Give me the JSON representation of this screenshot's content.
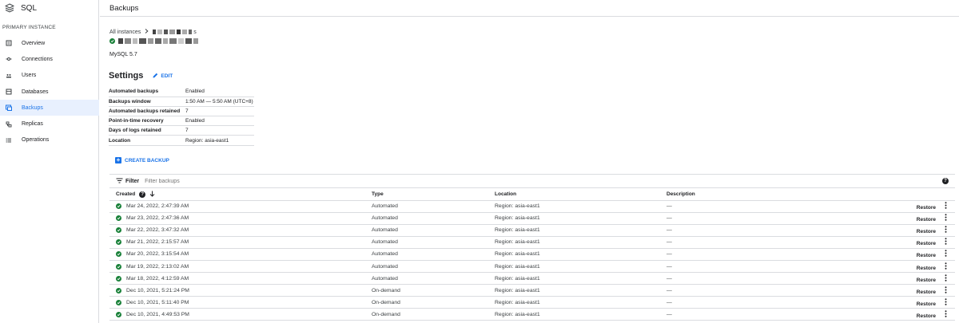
{
  "sidebar": {
    "product": "SQL",
    "section_title": "PRIMARY INSTANCE",
    "items": [
      {
        "label": "Overview"
      },
      {
        "label": "Connections"
      },
      {
        "label": "Users"
      },
      {
        "label": "Databases"
      },
      {
        "label": "Backups",
        "active": true
      },
      {
        "label": "Replicas"
      },
      {
        "label": "Operations"
      }
    ]
  },
  "header": {
    "title": "Backups"
  },
  "breadcrumb": {
    "all_instances": "All instances",
    "instance_suffix": "s"
  },
  "instance": {
    "version": "MySQL 5.7"
  },
  "settings": {
    "title": "Settings",
    "edit_label": "EDIT",
    "rows": [
      {
        "key": "Automated backups",
        "value": "Enabled"
      },
      {
        "key": "Backups window",
        "value": "1:50 AM — 5:50 AM (UTC+8)"
      },
      {
        "key": "Automated backups retained",
        "value": "7"
      },
      {
        "key": "Point-in-time recovery",
        "value": "Enabled"
      },
      {
        "key": "Days of logs retained",
        "value": "7"
      },
      {
        "key": "Location",
        "value": "Region: asia-east1"
      }
    ]
  },
  "create_backup_label": "CREATE BACKUP",
  "filter": {
    "label": "Filter",
    "placeholder": "Filter backups"
  },
  "table": {
    "columns": {
      "created": "Created",
      "type": "Type",
      "location": "Location",
      "description": "Description"
    },
    "restore_label": "Restore",
    "rows": [
      {
        "created": "Mar 24, 2022, 2:47:39 AM",
        "type": "Automated",
        "location": "Region: asia-east1",
        "description": "—"
      },
      {
        "created": "Mar 23, 2022, 2:47:36 AM",
        "type": "Automated",
        "location": "Region: asia-east1",
        "description": "—"
      },
      {
        "created": "Mar 22, 2022, 3:47:32 AM",
        "type": "Automated",
        "location": "Region: asia-east1",
        "description": "—"
      },
      {
        "created": "Mar 21, 2022, 2:15:57 AM",
        "type": "Automated",
        "location": "Region: asia-east1",
        "description": "—"
      },
      {
        "created": "Mar 20, 2022, 3:15:54 AM",
        "type": "Automated",
        "location": "Region: asia-east1",
        "description": "—"
      },
      {
        "created": "Mar 19, 2022, 2:13:02 AM",
        "type": "Automated",
        "location": "Region: asia-east1",
        "description": "—"
      },
      {
        "created": "Mar 18, 2022, 4:12:59 AM",
        "type": "Automated",
        "location": "Region: asia-east1",
        "description": "—"
      },
      {
        "created": "Dec 10, 2021, 5:21:24 PM",
        "type": "On-demand",
        "location": "Region: asia-east1",
        "description": "—"
      },
      {
        "created": "Dec 10, 2021, 5:11:40 PM",
        "type": "On-demand",
        "location": "Region: asia-east1",
        "description": "—"
      },
      {
        "created": "Dec 10, 2021, 4:49:53 PM",
        "type": "On-demand",
        "location": "Region: asia-east1",
        "description": "—"
      }
    ]
  },
  "colors": {
    "accent": "#1a73e8",
    "success": "#188038",
    "border": "#dadce0",
    "active_bg": "#e8f0fe"
  },
  "icons": {
    "nav": [
      "overview-icon",
      "connections-icon",
      "users-icon",
      "databases-icon",
      "backups-icon",
      "replicas-icon",
      "operations-icon"
    ]
  }
}
